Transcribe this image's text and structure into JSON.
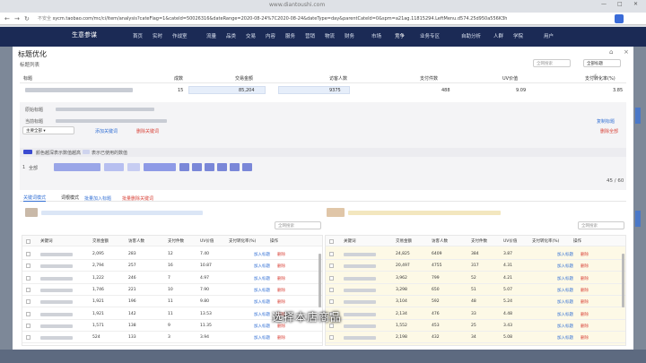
{
  "browser": {
    "watermark": "www.diantoushi.com",
    "security": "不安全",
    "url": "sycm.taobao.com/mc/ci/item/analysis?cateFlag=1&cateId=50026316&dateRange=2020-08-24%7C2020-08-24&dateType=day&parentCateId=0&spm=a21ag.11815294.LeftMenu.d574.25d950a556K3h"
  },
  "topnav": {
    "logo": "生意参谋",
    "items": [
      "首页",
      "实时",
      "作战室",
      "流量",
      "品类",
      "交易",
      "内容",
      "服务",
      "营销",
      "物流",
      "财务",
      "市场",
      "竞争",
      "业务专区",
      "自助分析",
      "人群",
      "学院"
    ],
    "user": "用户"
  },
  "modal": {
    "title": "标题优化",
    "close": "×",
    "pin": "⌂",
    "subtitle": "标题列表",
    "search_placeholder": "全网搜索",
    "dropdown": "全部标题"
  },
  "list": {
    "headers": [
      "标题",
      "成数",
      "交易金额",
      "访客人数",
      "支付件数",
      "UV价值",
      "支付转化率(%)"
    ],
    "row": {
      "title": "■■■■■■■■■■■■■■■■■■■■■■■■",
      "n": "15",
      "amount": "85,204",
      "visitors": "9375",
      "items": "488",
      "uv": "9.09",
      "rate": "3.85"
    }
  },
  "edit": {
    "orig_label": "原始标题",
    "cur_label": "当前标题",
    "select": "主要全部",
    "add_kw": "添加关键词",
    "del_kw": "删除关键词",
    "copy": "复制标题",
    "clear": "删除全部",
    "tip1": "颜色越深表示数值越高",
    "tip2": "表示已使用的数值",
    "line_no": "1",
    "line_text": "全部",
    "count": "45 / 60"
  },
  "tabs": [
    "关键词模式",
    "词根模式"
  ],
  "tab_actions": [
    "批量加入标题",
    "批量删除关键词"
  ],
  "table": {
    "search": "全网搜索",
    "headers": [
      "关键词",
      "交易金额",
      "访客人数",
      "支付件数",
      "UV价值",
      "支付转化率(%)",
      "操作"
    ],
    "add": "加入标题",
    "del": "删除",
    "left": [
      [
        "2,095",
        "283",
        "12",
        "7.40"
      ],
      [
        "2,794",
        "257",
        "16",
        "10.87"
      ],
      [
        "1,222",
        "246",
        "7",
        "4.97"
      ],
      [
        "1,746",
        "221",
        "10",
        "7.90"
      ],
      [
        "1,921",
        "196",
        "11",
        "9.80"
      ],
      [
        "1,921",
        "142",
        "11",
        "13.53"
      ],
      [
        "1,571",
        "138",
        "9",
        "11.35"
      ],
      [
        "524",
        "133",
        "3",
        "3.94"
      ]
    ],
    "right": [
      [
        "24,825",
        "6409",
        "384",
        "3.87"
      ],
      [
        "20,497",
        "4755",
        "317",
        "4.31"
      ],
      [
        "3,962",
        "799",
        "52",
        "4.21"
      ],
      [
        "3,298",
        "650",
        "51",
        "5.07"
      ],
      [
        "3,104",
        "592",
        "48",
        "5.24"
      ],
      [
        "2,134",
        "476",
        "33",
        "4.48"
      ],
      [
        "1,552",
        "453",
        "25",
        "3.43"
      ],
      [
        "2,198",
        "432",
        "34",
        "5.08"
      ]
    ]
  },
  "caption": "选择本店商品"
}
